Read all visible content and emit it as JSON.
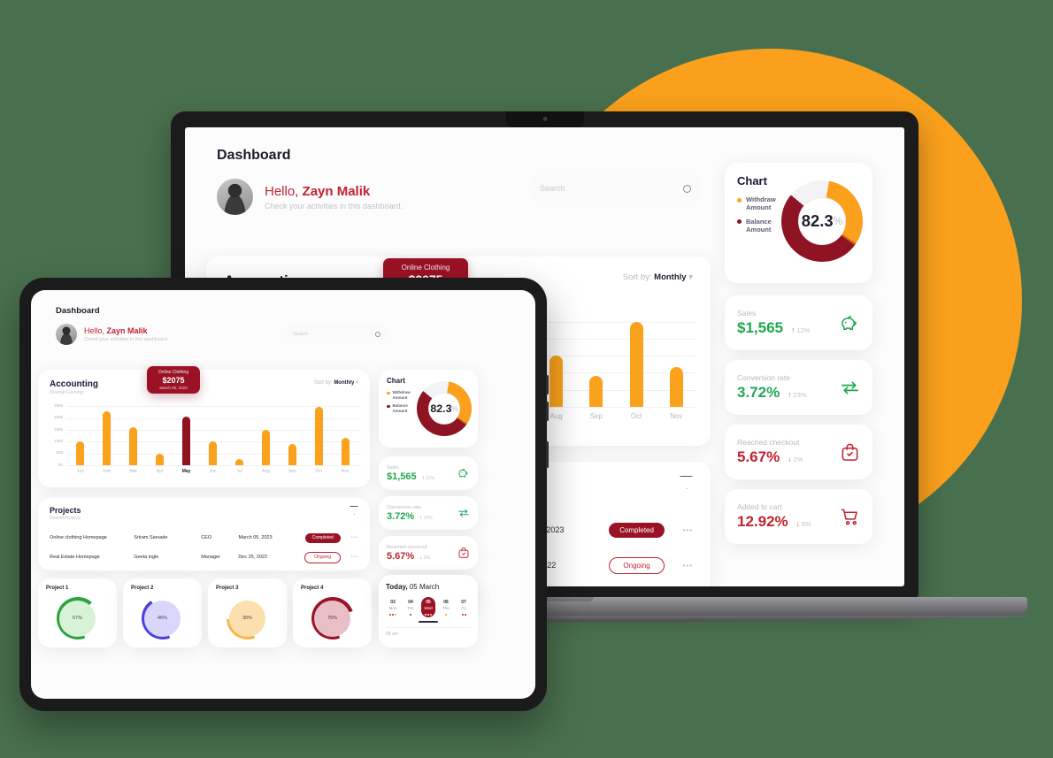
{
  "theme": {
    "background": "#49704e",
    "accent_orange": "#fba01c",
    "accent_red": "#9b1225",
    "accent_green": "#1fa750",
    "bar_color": "#faa21b",
    "bar_highlight": "#8e1424"
  },
  "app": {
    "breadcrumb": "Dashboard",
    "search": {
      "placeholder": "Search",
      "value": "",
      "icon": "search-icon"
    },
    "greeting": {
      "hello": "Hello,",
      "name": "Zayn Malik",
      "subtitle": "Check your activities in this dashboard."
    }
  },
  "accounting": {
    "title": "Accounting",
    "subtitle": "Overall Earning",
    "sort_label": "Sort by:",
    "sort_value": "Monthly",
    "sort_caret": "▾",
    "tooltip": {
      "label": "Online Clothing",
      "amount": "$2075",
      "date": "March 05, 2023"
    }
  },
  "chart_data": {
    "type": "bar",
    "title": "Accounting",
    "subtitle": "Overall Earning",
    "xlabel": "",
    "ylabel": "",
    "categories": [
      "Jan",
      "Feb",
      "Mar",
      "Apr",
      "May",
      "Jun",
      "Jul",
      "Aug",
      "Sep",
      "Oct",
      "Nov"
    ],
    "values": [
      1000,
      2300,
      1600,
      480,
      2075,
      1030,
      250,
      1500,
      900,
      2490,
      1180
    ],
    "ytick_labels": [
      "2500",
      "2000",
      "1500",
      "1000",
      "500",
      "00"
    ],
    "ytick_values": [
      2500,
      2000,
      1500,
      1000,
      500,
      0
    ],
    "ylim": [
      0,
      2700
    ],
    "highlight_index": 4,
    "highlight_label": "May",
    "grid": true,
    "legend": "none",
    "colors": {
      "bar": "#faa21b",
      "highlight": "#8e1424"
    }
  },
  "donut_chart": {
    "title": "Chart",
    "center_value": "82.3",
    "center_unit": "%",
    "legend": [
      {
        "label": "Withdraw Amount",
        "line1": "Withdraw",
        "line2": "Amount",
        "color": "#faa21b"
      },
      {
        "label": "Balance Amount",
        "line1": "Balance",
        "line2": "Amount",
        "color": "#8e1424"
      }
    ]
  },
  "stats": [
    {
      "label": "Sales",
      "value": "$1,565",
      "delta": "12%",
      "direction": "up",
      "arrow": "↑",
      "icon": "piggy-bank-icon",
      "tone": "green"
    },
    {
      "label": "Conversion rate",
      "value": "3.72%",
      "delta": "23%",
      "direction": "up",
      "arrow": "↑",
      "icon": "exchange-icon",
      "tone": "green"
    },
    {
      "label": "Reached checkout",
      "value": "5.67%",
      "delta": "2%",
      "direction": "down",
      "arrow": "↓",
      "icon": "checkout-bag-icon",
      "tone": "red"
    },
    {
      "label": "Added to cart",
      "value": "12.92%",
      "delta": "5%",
      "direction": "down",
      "arrow": "↓",
      "icon": "cart-icon",
      "tone": "red"
    }
  ],
  "projects": {
    "title": "Projects",
    "subtitle": "Overall Projects",
    "filter_icon": "filter-funnel-icon",
    "rows": [
      {
        "name": "Online clothing Homepage",
        "owner": "Sriram Sarvade",
        "role": "CEO",
        "date": "March 05, 2023",
        "status": "Completed",
        "status_type": "done",
        "menu": "•••"
      },
      {
        "name": "Real Estate Homepage",
        "owner": "Geeta ingle",
        "role": "Manager",
        "date": "Dec 25, 2022",
        "status": "Ongoing",
        "status_type": "ongoing",
        "menu": "•••"
      }
    ]
  },
  "project_cards": [
    {
      "title": "Project 1",
      "percent": "67%",
      "value": 67,
      "color": "#2aa33f",
      "track": "#d8f2d8"
    },
    {
      "title": "Project 2",
      "percent": "46%",
      "value": 46,
      "color": "#4b3fe0",
      "track": "#d9d6fb"
    },
    {
      "title": "Project 3",
      "percent": "30%",
      "value": 30,
      "color": "#f7b64b",
      "track": "#fbdfae"
    },
    {
      "title": "Project 4",
      "percent": "75%",
      "value": 75,
      "color": "#9b1225",
      "track": "#e8bfc6"
    }
  ],
  "today": {
    "title_prefix": "Today,",
    "title_date": "05 March",
    "time_label": "08 am",
    "days": [
      {
        "num": "03",
        "dow": "Mon",
        "selected": false,
        "dots": [
          "#c2222f",
          "#c2222f",
          "#faa21b"
        ]
      },
      {
        "num": "04",
        "dow": "Tue",
        "selected": false,
        "dots": [
          "#c2222f"
        ]
      },
      {
        "num": "05",
        "dow": "Wed",
        "selected": true,
        "dots": [
          "#ffffff",
          "#ffffff",
          "#ffd9a0"
        ]
      },
      {
        "num": "06",
        "dow": "Thu",
        "selected": false,
        "dots": [
          "#faa21b"
        ]
      },
      {
        "num": "07",
        "dow": "Fri",
        "selected": false,
        "dots": [
          "#c2222f",
          "#c2222f"
        ]
      }
    ]
  }
}
